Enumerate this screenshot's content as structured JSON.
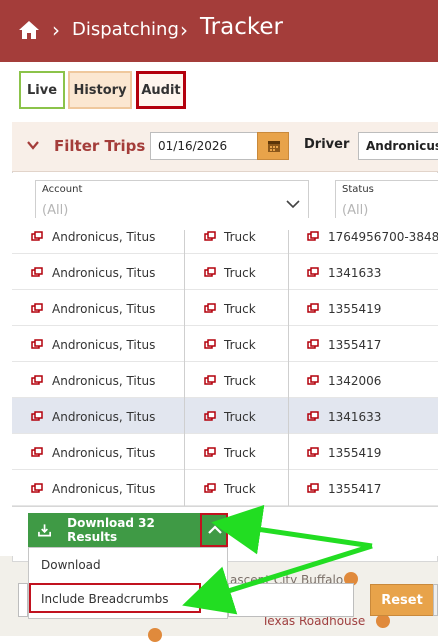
{
  "breadcrumb": {
    "home_icon": "home-icon",
    "items": [
      "Dispatching",
      "Tracker"
    ]
  },
  "tabs": [
    {
      "label": "Live",
      "active": false
    },
    {
      "label": "History",
      "active": false
    },
    {
      "label": "Audit",
      "active": true
    }
  ],
  "filter": {
    "title": "Filter Trips",
    "date_value": "01/16/2026",
    "date_icon": "calendar-icon",
    "driver_label": "Driver",
    "driver_value": "Andronicus, Titus"
  },
  "selects": [
    {
      "label": "Account",
      "value": "(All)"
    },
    {
      "label": "Status",
      "value": "(All)"
    }
  ],
  "rows": [
    {
      "driver": "Andronicus, Titus",
      "vehicle": "Truck",
      "trip": "1764956700-3848",
      "selected": false
    },
    {
      "driver": "Andronicus, Titus",
      "vehicle": "Truck",
      "trip": "1341633",
      "selected": false
    },
    {
      "driver": "Andronicus, Titus",
      "vehicle": "Truck",
      "trip": "1355419",
      "selected": false
    },
    {
      "driver": "Andronicus, Titus",
      "vehicle": "Truck",
      "trip": "1355417",
      "selected": false
    },
    {
      "driver": "Andronicus, Titus",
      "vehicle": "Truck",
      "trip": "1342006",
      "selected": false
    },
    {
      "driver": "Andronicus, Titus",
      "vehicle": "Truck",
      "trip": "1341633",
      "selected": true
    },
    {
      "driver": "Andronicus, Titus",
      "vehicle": "Truck",
      "trip": "1355419",
      "selected": false
    },
    {
      "driver": "Andronicus, Titus",
      "vehicle": "Truck",
      "trip": "1355417",
      "selected": false
    }
  ],
  "download": {
    "label": "Download 32 Results",
    "menu": [
      "Download",
      "Include Breadcrumbs"
    ]
  },
  "reset_label": "Reset",
  "map_labels": {
    "place1": "ascent City Buffalo",
    "place2": "Texas Roadhouse"
  },
  "colors": {
    "header": "#a43d3a",
    "accent_green": "#3f9a45",
    "highlight_red": "#c1121f",
    "arrow_green": "#22dd22",
    "button_orange": "#e8a34a"
  }
}
